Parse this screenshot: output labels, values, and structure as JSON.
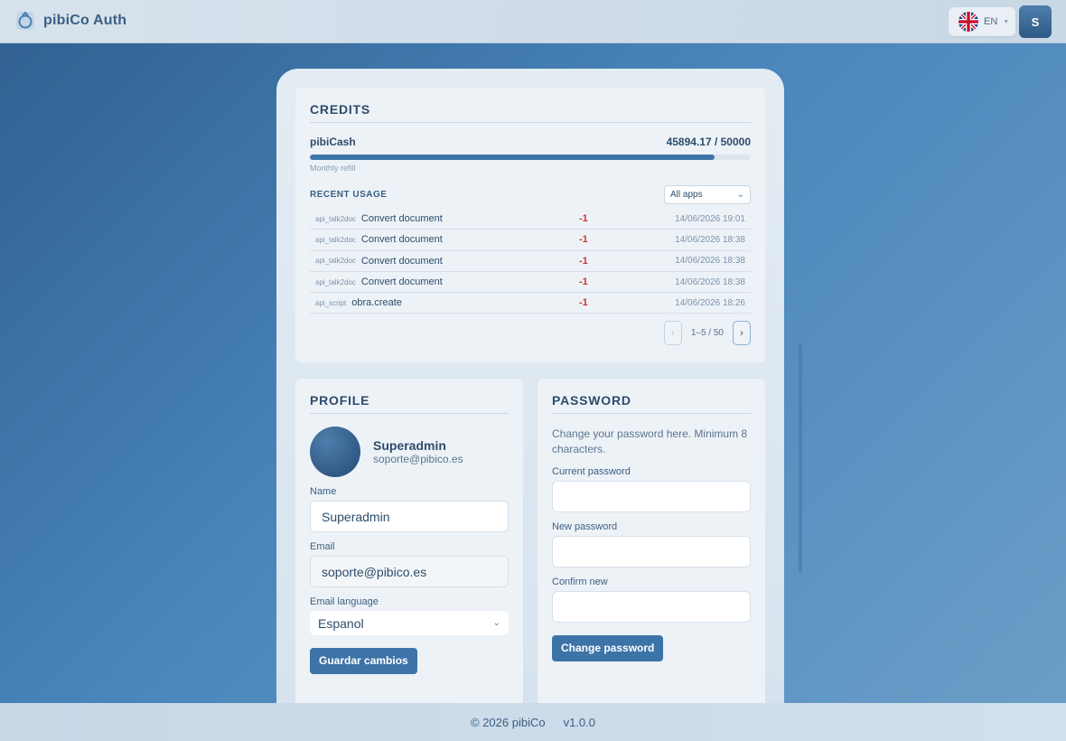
{
  "header": {
    "brand": "pibiCo Auth",
    "language_code": "EN",
    "avatar_initial": "S"
  },
  "credits": {
    "title": "CREDITS",
    "currency": "pibiCash",
    "balance_text": "45894.17 / 50000",
    "balance": 45894.17,
    "limit": 50000,
    "refill_label": "Monthly refill",
    "recent_usage_title": "RECENT USAGE",
    "app_filter": "All apps",
    "usage": [
      {
        "app": "api_talk2doc",
        "desc": "Convert document",
        "amount": "-1",
        "date": "14/06/2026 19:01"
      },
      {
        "app": "api_talk2doc",
        "desc": "Convert document",
        "amount": "-1",
        "date": "14/06/2026 18:38"
      },
      {
        "app": "api_talk2doc",
        "desc": "Convert document",
        "amount": "-1",
        "date": "14/06/2026 18:38"
      },
      {
        "app": "api_talk2doc",
        "desc": "Convert document",
        "amount": "-1",
        "date": "14/06/2026 18:38"
      },
      {
        "app": "api_script",
        "desc": "obra.create",
        "amount": "-1",
        "date": "14/06/2026 18:26"
      }
    ],
    "pager_text": "1–5 / 50",
    "pager_prev": "‹",
    "pager_next": "›"
  },
  "profile": {
    "title": "PROFILE",
    "user_name": "Superadmin",
    "user_email": "soporte@pibico.es",
    "name_label": "Name",
    "name_value": "Superadmin",
    "email_label": "Email",
    "email_value": "soporte@pibico.es",
    "lang_label": "Email language",
    "lang_value": "Espanol",
    "save_label": "Guardar cambios"
  },
  "password": {
    "title": "PASSWORD",
    "intro": "Change your password here. Minimum 8 characters.",
    "current_label": "Current password",
    "new_label": "New password",
    "confirm_label": "Confirm new",
    "submit_label": "Change password"
  },
  "footer": {
    "copyright": "© 2026 pibiCo",
    "version": "v1.0.0"
  },
  "colors": {
    "accent": "#3d74a8",
    "negative": "#d0342c"
  }
}
